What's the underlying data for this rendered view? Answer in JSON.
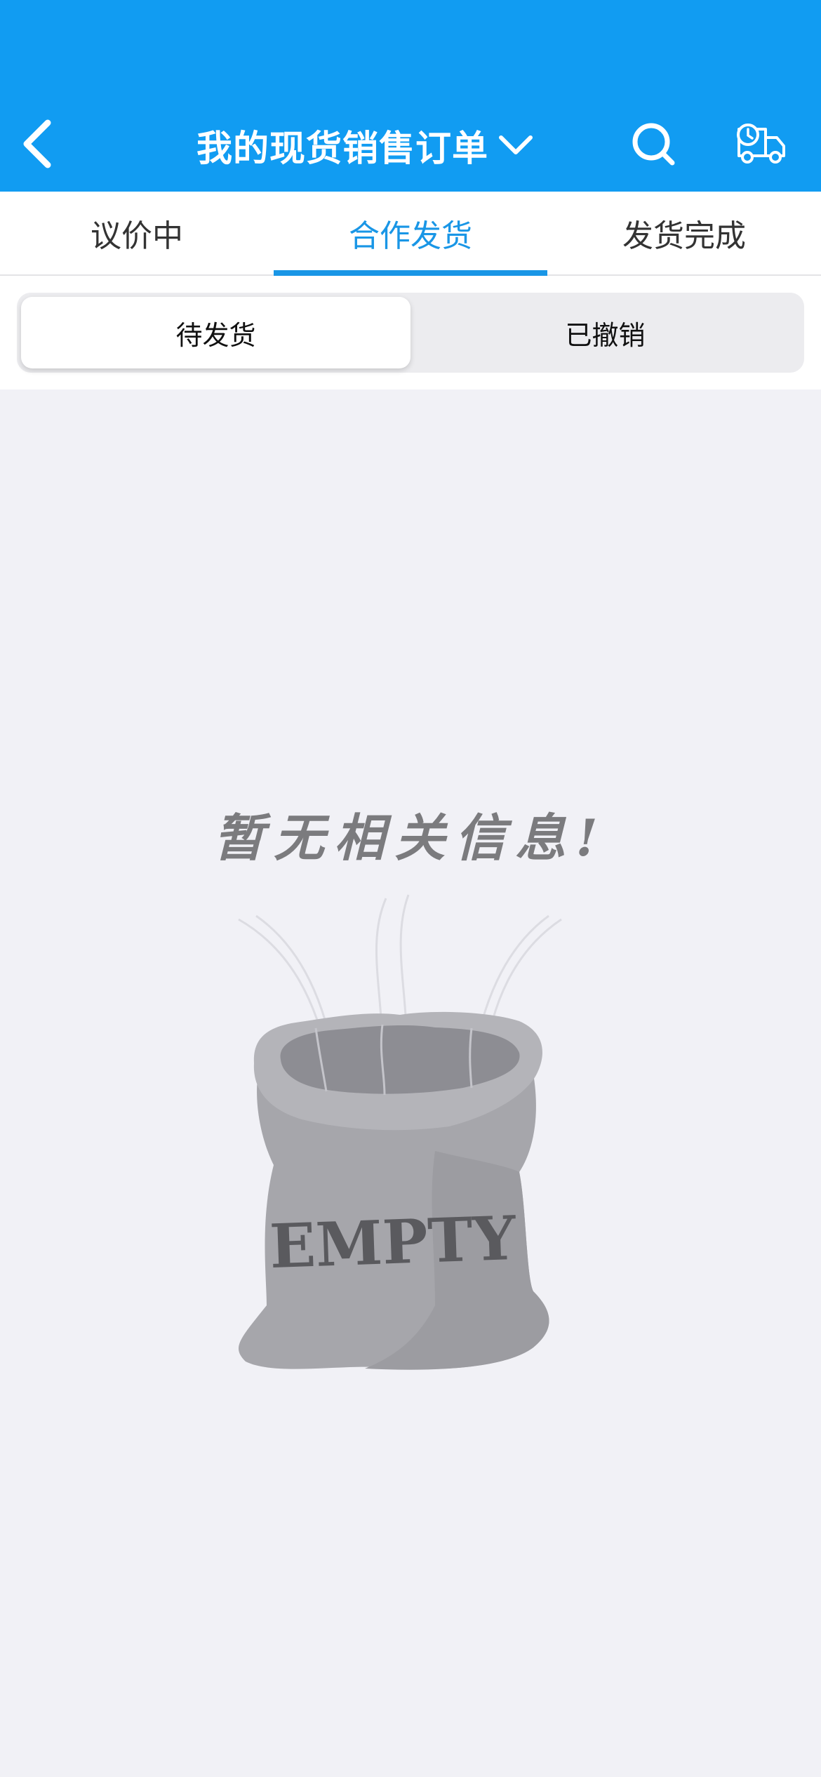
{
  "header": {
    "title": "我的现货销售订单",
    "back_icon": "chevron-left-icon",
    "dropdown_icon": "chevron-down-icon",
    "search_icon": "search-icon",
    "delivery_icon": "delivery-truck-clock-icon",
    "background_color": "#119cf2"
  },
  "tabs": [
    {
      "label": "议价中",
      "active": false
    },
    {
      "label": "合作发货",
      "active": true
    },
    {
      "label": "发货完成",
      "active": false
    }
  ],
  "segments": [
    {
      "label": "待发货",
      "active": true
    },
    {
      "label": "已撤销",
      "active": false
    }
  ],
  "empty_state": {
    "message": "暂无相关信息!",
    "bag_label": "EMPTY",
    "illustration_icon": "empty-sack-icon"
  },
  "colors": {
    "accent": "#1996e6",
    "page_background": "#f1f1f6"
  }
}
